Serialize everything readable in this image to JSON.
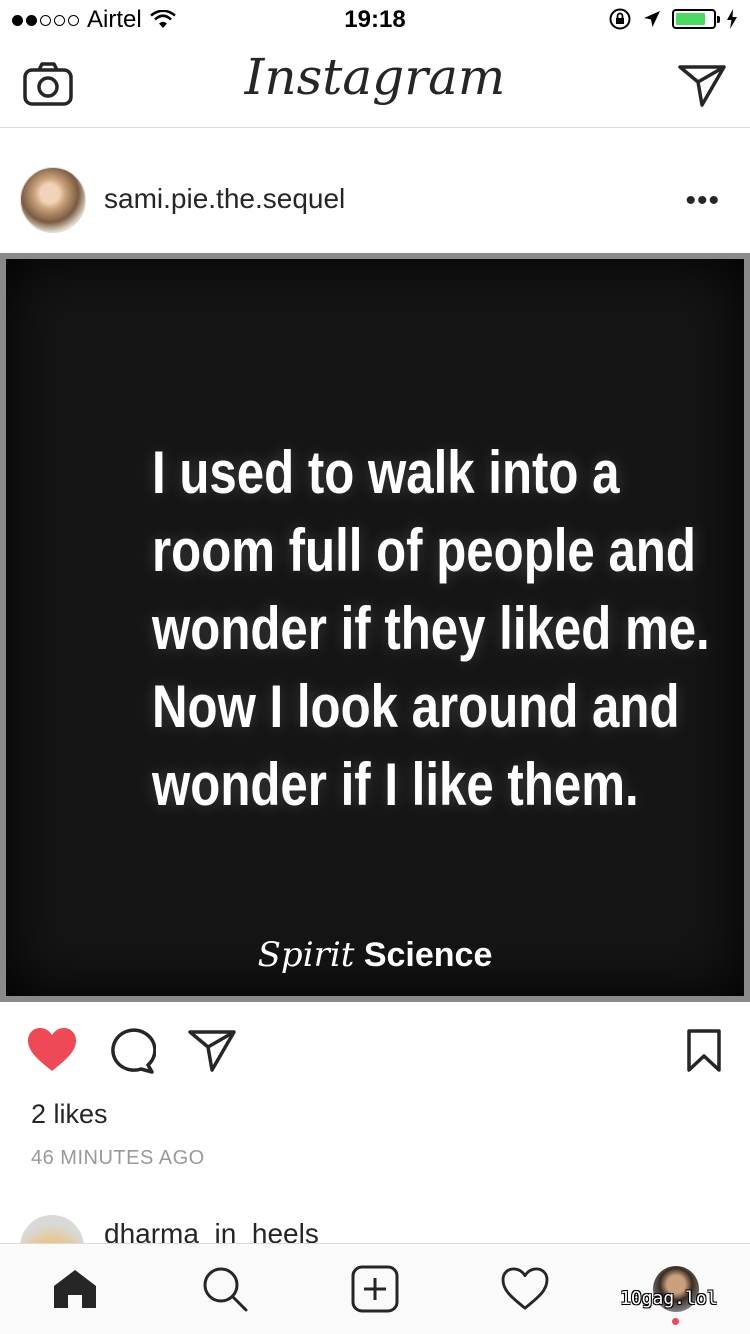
{
  "status_bar": {
    "carrier": "Airtel",
    "time": "19:18",
    "battery_level": 0.8,
    "signal_bars": 2
  },
  "nav": {
    "logo": "Instagram"
  },
  "post": {
    "username": "sami.pie.the.sequel",
    "more_label": "•••",
    "image_text": [
      "I used to walk into a",
      "room full of people and",
      "wonder if they liked me.",
      "Now I look around and",
      "wonder if I like them."
    ],
    "image_brand_script": "Spirit",
    "image_brand": "Science",
    "likes": "2 likes",
    "time_ago": "46 MINUTES AGO",
    "liked": true
  },
  "next_post": {
    "username": "dharma_in_heels"
  },
  "watermark": "10gag.lol",
  "colors": {
    "like_red": "#ed4956",
    "battery_green": "#4cd964",
    "text": "#262626",
    "muted": "#999999"
  },
  "icons": [
    "camera-icon",
    "direct-message-icon",
    "heart-icon",
    "comment-icon",
    "share-icon",
    "bookmark-icon",
    "home-icon",
    "search-icon",
    "add-post-icon",
    "activity-icon"
  ]
}
